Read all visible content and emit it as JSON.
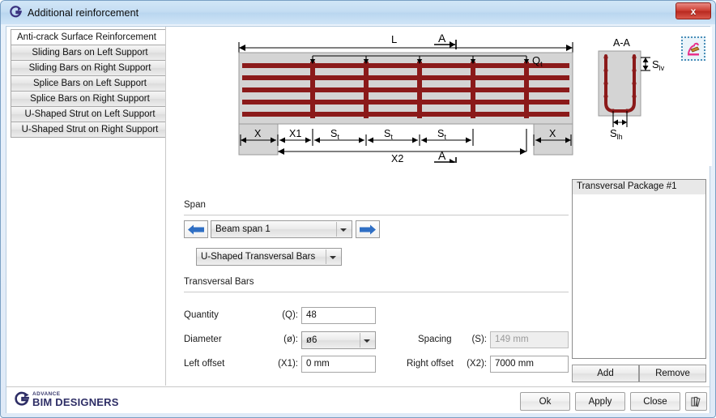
{
  "window": {
    "title": "Additional reinforcement",
    "app_icon": "advance-g-icon",
    "close_label": "x"
  },
  "sidebar": {
    "items": [
      {
        "label": "Anti-crack Surface Reinforcement",
        "selected": true
      },
      {
        "label": "Sliding Bars on Left Support",
        "selected": false
      },
      {
        "label": "Sliding Bars on Right Support",
        "selected": false
      },
      {
        "label": "Splice Bars on Left Support",
        "selected": false
      },
      {
        "label": "Splice Bars on Right Support",
        "selected": false
      },
      {
        "label": "U-Shaped Strut on Left Support",
        "selected": false
      },
      {
        "label": "U-Shaped Strut on Right Support",
        "selected": false
      }
    ]
  },
  "diagram": {
    "tool_icon": "draw-pen-icon",
    "elevation": {
      "labels": {
        "length": "L",
        "section_top": "A",
        "section_bottom": "A",
        "load": "Q",
        "load_sub": "t",
        "left_support": "X",
        "right_support": "X",
        "first_offset": "X1",
        "last_offset": "X2",
        "spacing_1": "S",
        "spacing_1_sub": "t",
        "spacing_2": "S",
        "spacing_2_sub": "t",
        "spacing_3": "S",
        "spacing_3_sub": "t"
      },
      "colors": {
        "concrete": "#d4d4d4",
        "rebar": "#8b1a1a",
        "dimension": "#000000"
      },
      "longitudinal_bar_count": 5,
      "transversal_bar_count": 5
    },
    "cross_section": {
      "title": "A-A",
      "vertical_spacing_label": "S",
      "vertical_spacing_sub": "lv",
      "horizontal_spacing_label": "S",
      "horizontal_spacing_sub": "lh"
    }
  },
  "form": {
    "span_group_label": "Span",
    "span_select": {
      "value": "Beam span 1",
      "prev_icon": "arrow-left-icon",
      "next_icon": "arrow-right-icon"
    },
    "type_select": {
      "value": "U-Shaped Transversal Bars"
    },
    "bars_group_label": "Transversal Bars",
    "fields": [
      {
        "label": "Quantity",
        "code": "(Q):",
        "value": "48",
        "disabled": false
      },
      {
        "label": "Diameter",
        "code": "(ø):",
        "value": "ø6",
        "disabled": false,
        "combo": true
      },
      {
        "label": "Left offset",
        "code": "(X1):",
        "value": "0 mm",
        "disabled": false
      },
      {
        "label": "Spacing",
        "code": "(S):",
        "value": "149 mm",
        "disabled": true
      },
      {
        "label": "Right offset",
        "code": "(X2):",
        "value": "7000 mm",
        "disabled": false
      }
    ]
  },
  "packages": {
    "items": [
      {
        "label": "Transversal Package #1",
        "selected": true
      }
    ],
    "add_label": "Add",
    "remove_label": "Remove"
  },
  "footer": {
    "logo_top": "ADVANCE",
    "logo_main": "BIM DESIGNERS",
    "ok_label": "Ok",
    "apply_label": "Apply",
    "close_label": "Close",
    "extra_icon": "books-icon"
  }
}
